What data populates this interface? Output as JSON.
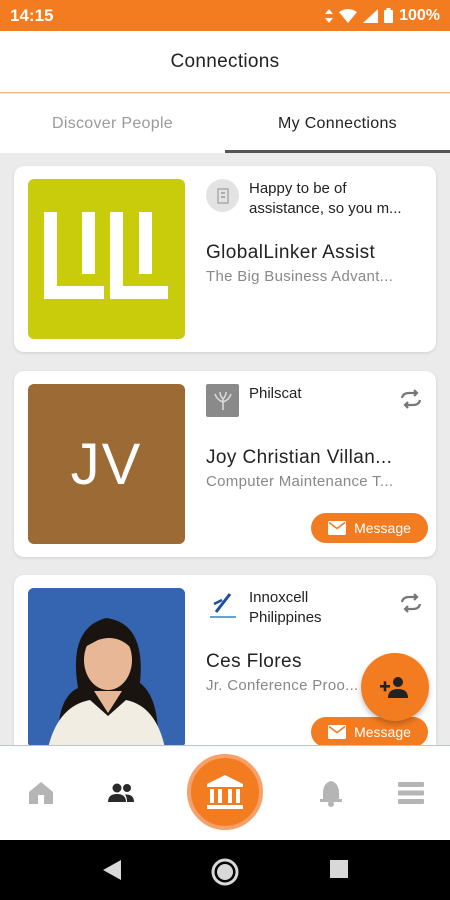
{
  "status_bar": {
    "time": "14:15",
    "battery": "100%"
  },
  "app_bar": {
    "title": "Connections"
  },
  "tabs": [
    {
      "label": "Discover People",
      "active": false
    },
    {
      "label": "My Connections",
      "active": true
    }
  ],
  "cards": [
    {
      "org": "Happy to be of assistance, so you m...",
      "name": "GlobalLinker Assist",
      "subtitle": "The Big Business Advant...",
      "thumb_color": "#c8cc0a",
      "message_label": ""
    },
    {
      "org": "Philscat",
      "name": "Joy Christian Villan...",
      "subtitle": "Computer Maintenance T...",
      "initials": "JV",
      "thumb_color": "#9b6a35",
      "message_label": "Message"
    },
    {
      "org": "Innoxcell Philippines",
      "name": "Ces Flores",
      "subtitle": "Jr. Conference Proo...",
      "thumb_color": "#2e5ca8",
      "message_label": "Message"
    }
  ],
  "colors": {
    "accent": "#f47c20",
    "accent_light": "#f7a06a"
  },
  "icons": [
    "wifi-icon",
    "signal-icon",
    "battery-icon",
    "sync-icon",
    "mail-icon",
    "add-person-icon",
    "home-icon",
    "people-icon",
    "institution-icon",
    "bell-icon",
    "menu-icon",
    "back-icon",
    "home-circle-icon",
    "recents-icon"
  ]
}
